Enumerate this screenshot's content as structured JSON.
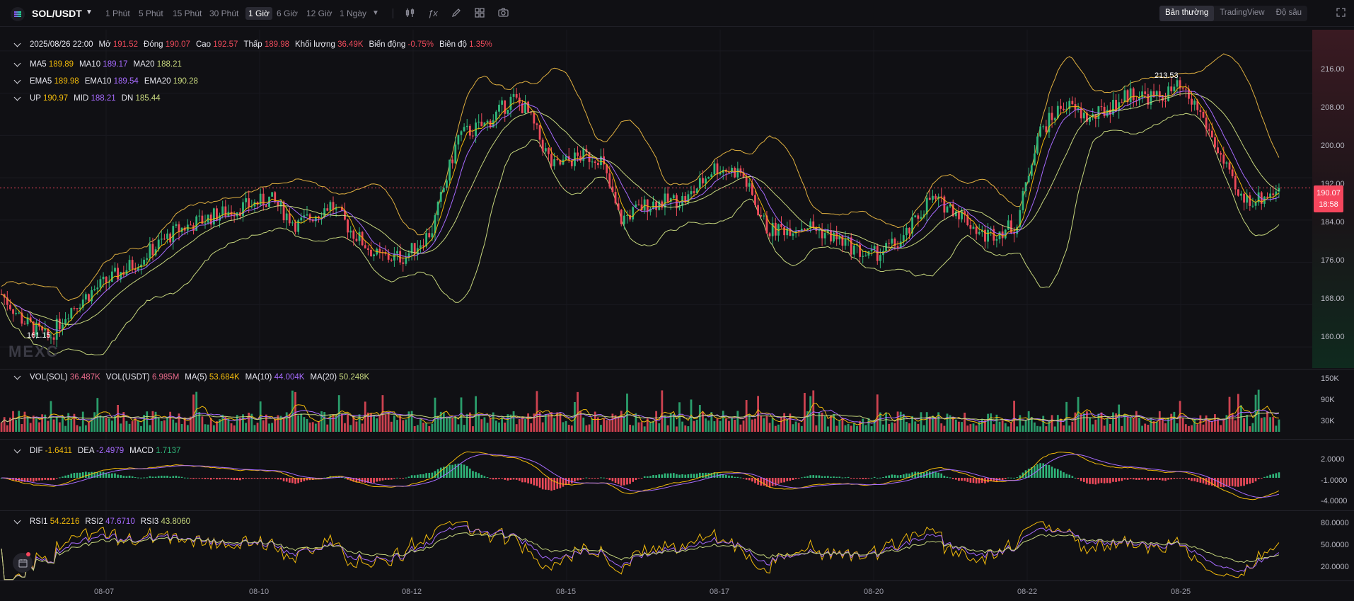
{
  "header": {
    "symbol": "SOL/USDT",
    "timeframes": [
      "1 Phút",
      "5 Phút",
      "15 Phút",
      "30 Phút",
      "1 Giờ",
      "6 Giờ",
      "12 Giờ",
      "1 Ngày"
    ],
    "active_timeframe": "1 Giờ",
    "views": [
      "Bản thường",
      "TradingView",
      "Độ sâu"
    ],
    "active_view": "Bản thường"
  },
  "ohlc": {
    "date": "2025/08/26 22:00",
    "open_label": "Mở",
    "open": "191.52",
    "close_label": "Đóng",
    "close": "190.07",
    "high_label": "Cao",
    "high": "192.57",
    "low_label": "Thấp",
    "low": "189.98",
    "volume_label": "Khối lượng",
    "volume": "36.49K",
    "change_label": "Biến động",
    "change": "-0.75%",
    "amplitude_label": "Biên độ",
    "amplitude": "1.35%"
  },
  "ma": {
    "l1": "MA5",
    "v1": "189.89",
    "l2": "MA10",
    "v2": "189.17",
    "l3": "MA20",
    "v3": "188.21"
  },
  "ema": {
    "l1": "EMA5",
    "v1": "189.98",
    "l2": "EMA10",
    "v2": "189.54",
    "l3": "EMA20",
    "v3": "190.28"
  },
  "boll": {
    "l1": "UP",
    "v1": "190.97",
    "l2": "MID",
    "v2": "188.21",
    "l3": "DN",
    "v3": "185.44"
  },
  "vol": {
    "l1": "VOL(SOL)",
    "v1": "36.487K",
    "l2": "VOL(USDT)",
    "v2": "6.985M",
    "l3": "MA(5)",
    "v3": "53.684K",
    "l4": "MA(10)",
    "v4": "44.004K",
    "l5": "MA(20)",
    "v5": "50.248K"
  },
  "macd": {
    "l1": "DIF",
    "v1": "-1.6411",
    "l2": "DEA",
    "v2": "-2.4979",
    "l3": "MACD",
    "v3": "1.7137"
  },
  "rsi": {
    "l1": "RSI1",
    "v1": "54.2216",
    "l2": "RSI2",
    "v2": "47.6710",
    "l3": "RSI3",
    "v3": "43.8060"
  },
  "price_axis": [
    "216.00",
    "208.00",
    "200.00",
    "192.00",
    "184.00",
    "176.00",
    "168.00",
    "160.00"
  ],
  "volume_axis": [
    "150K",
    "90K",
    "30K"
  ],
  "macd_axis": [
    "2.0000",
    "-1.0000",
    "-4.0000"
  ],
  "rsi_axis": [
    "80.0000",
    "50.0000",
    "20.0000"
  ],
  "last_price": "190.07",
  "countdown": "18:58",
  "highest_marker": "213.53",
  "lowest_marker": "161.15",
  "x_dates": [
    "08-07",
    "08-10",
    "08-12",
    "08-15",
    "08-17",
    "08-20",
    "08-22",
    "08-25"
  ],
  "watermark": "MEXC",
  "colors": {
    "up": "#2fb67a",
    "down": "#ef4b5b",
    "ma5": "#f0b90b",
    "ma10": "#a76bff",
    "ma20": "#c6d67d",
    "bg": "#101014"
  },
  "chart_data": {
    "type": "candlestick",
    "title": "SOL/USDT 1 Giờ",
    "ylim": [
      156,
      220
    ],
    "x_range": [
      "08-06",
      "08-26"
    ],
    "price_anchors": [
      {
        "x": 0,
        "y": 170
      },
      {
        "x": 0.016,
        "y": 165
      },
      {
        "x": 0.035,
        "y": 161.5
      },
      {
        "x": 0.05,
        "y": 167
      },
      {
        "x": 0.07,
        "y": 171
      },
      {
        "x": 0.1,
        "y": 176
      },
      {
        "x": 0.13,
        "y": 182
      },
      {
        "x": 0.16,
        "y": 185
      },
      {
        "x": 0.2,
        "y": 188
      },
      {
        "x": 0.22,
        "y": 183
      },
      {
        "x": 0.245,
        "y": 187
      },
      {
        "x": 0.26,
        "y": 182
      },
      {
        "x": 0.28,
        "y": 177
      },
      {
        "x": 0.3,
        "y": 177
      },
      {
        "x": 0.32,
        "y": 182
      },
      {
        "x": 0.34,
        "y": 200
      },
      {
        "x": 0.36,
        "y": 202
      },
      {
        "x": 0.38,
        "y": 207
      },
      {
        "x": 0.39,
        "y": 205
      },
      {
        "x": 0.41,
        "y": 194
      },
      {
        "x": 0.43,
        "y": 196
      },
      {
        "x": 0.445,
        "y": 196
      },
      {
        "x": 0.46,
        "y": 184
      },
      {
        "x": 0.48,
        "y": 187
      },
      {
        "x": 0.51,
        "y": 188
      },
      {
        "x": 0.53,
        "y": 194
      },
      {
        "x": 0.55,
        "y": 193
      },
      {
        "x": 0.57,
        "y": 182
      },
      {
        "x": 0.6,
        "y": 183
      },
      {
        "x": 0.625,
        "y": 180
      },
      {
        "x": 0.645,
        "y": 177
      },
      {
        "x": 0.67,
        "y": 180
      },
      {
        "x": 0.69,
        "y": 188
      },
      {
        "x": 0.71,
        "y": 186
      },
      {
        "x": 0.73,
        "y": 181
      },
      {
        "x": 0.755,
        "y": 183
      },
      {
        "x": 0.77,
        "y": 200
      },
      {
        "x": 0.79,
        "y": 206
      },
      {
        "x": 0.81,
        "y": 203
      },
      {
        "x": 0.84,
        "y": 208
      },
      {
        "x": 0.86,
        "y": 207
      },
      {
        "x": 0.875,
        "y": 209
      },
      {
        "x": 0.89,
        "y": 205
      },
      {
        "x": 0.905,
        "y": 197
      },
      {
        "x": 0.92,
        "y": 188
      },
      {
        "x": 0.935,
        "y": 188
      },
      {
        "x": 0.95,
        "y": 190
      }
    ],
    "last_close": 190.07,
    "high": 213.53,
    "low": 161.15
  }
}
